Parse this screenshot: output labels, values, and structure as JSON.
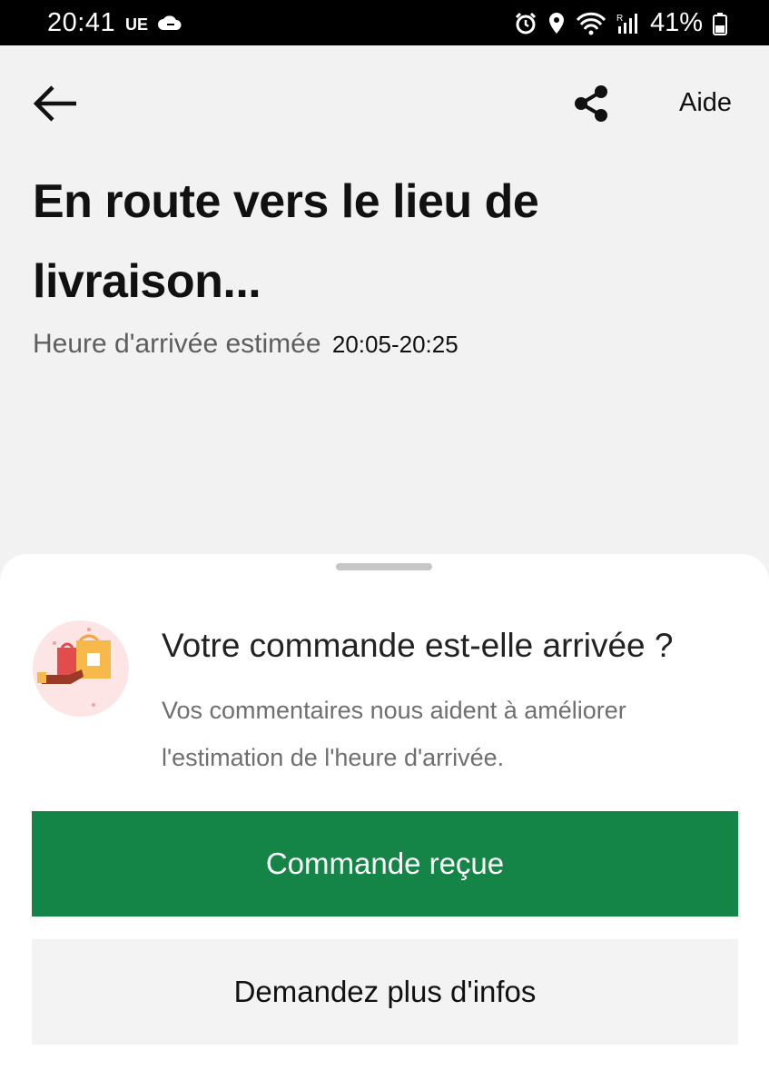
{
  "status_bar": {
    "time": "20:41",
    "carrier": "UE",
    "battery": "41%",
    "icons": [
      "cloud-icon",
      "alarm-icon",
      "location-icon",
      "wifi-icon",
      "signal-icon",
      "battery-icon"
    ]
  },
  "header": {
    "back_icon": "arrow-left-icon",
    "share_icon": "share-icon",
    "help_label": "Aide"
  },
  "status": {
    "title": "En route vers le lieu de livraison...",
    "eta_label": "Heure d'arrivée estimée",
    "eta_time": "20:05-20:25"
  },
  "sheet": {
    "illustration_icon": "shopping-bags-icon",
    "question": "Votre commande est-elle arrivée ?",
    "subtitle": "Vos commentaires nous aident à améliorer l'estimation de l'heure d'arrivée.",
    "primary_button": "Commande reçue",
    "secondary_button": "Demandez plus d'infos"
  },
  "colors": {
    "primary_green": "#148547",
    "background": "#f2f2f2",
    "sheet": "#ffffff",
    "illustration_bg": "#fde5e5"
  }
}
